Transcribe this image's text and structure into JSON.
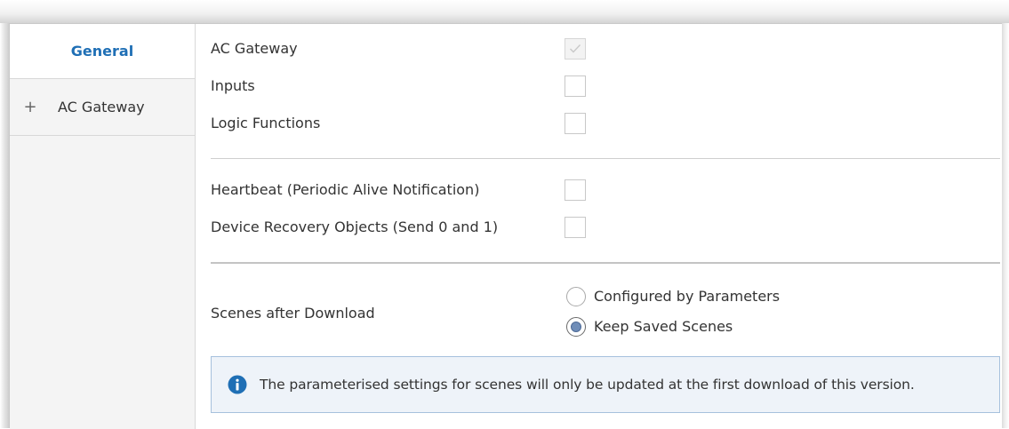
{
  "sidebar": {
    "items": [
      {
        "label": "General",
        "selected": true
      },
      {
        "label": "AC Gateway",
        "expand_icon": "plus-icon",
        "selected": false
      }
    ]
  },
  "main": {
    "options": [
      {
        "label": "AC Gateway",
        "checked": true,
        "disabled": true
      },
      {
        "label": "Inputs",
        "checked": false
      },
      {
        "label": "Logic Functions",
        "checked": false
      }
    ],
    "options2": [
      {
        "label": "Heartbeat (Periodic Alive Notification)",
        "checked": false
      },
      {
        "label": "Device Recovery Objects (Send 0 and 1)",
        "checked": false
      }
    ],
    "scenes": {
      "label": "Scenes after Download",
      "choices": [
        {
          "label": "Configured by Parameters",
          "selected": false
        },
        {
          "label": "Keep Saved Scenes",
          "selected": true
        }
      ]
    },
    "info": {
      "icon": "info-icon",
      "text": "The parameterised settings for scenes will only be updated at the first download of this version."
    }
  },
  "colors": {
    "accent": "#1f6fb5",
    "info_border": "#a6c1dd",
    "info_bg": "#eef3f9",
    "sidebar_bg": "#f4f4f4"
  }
}
